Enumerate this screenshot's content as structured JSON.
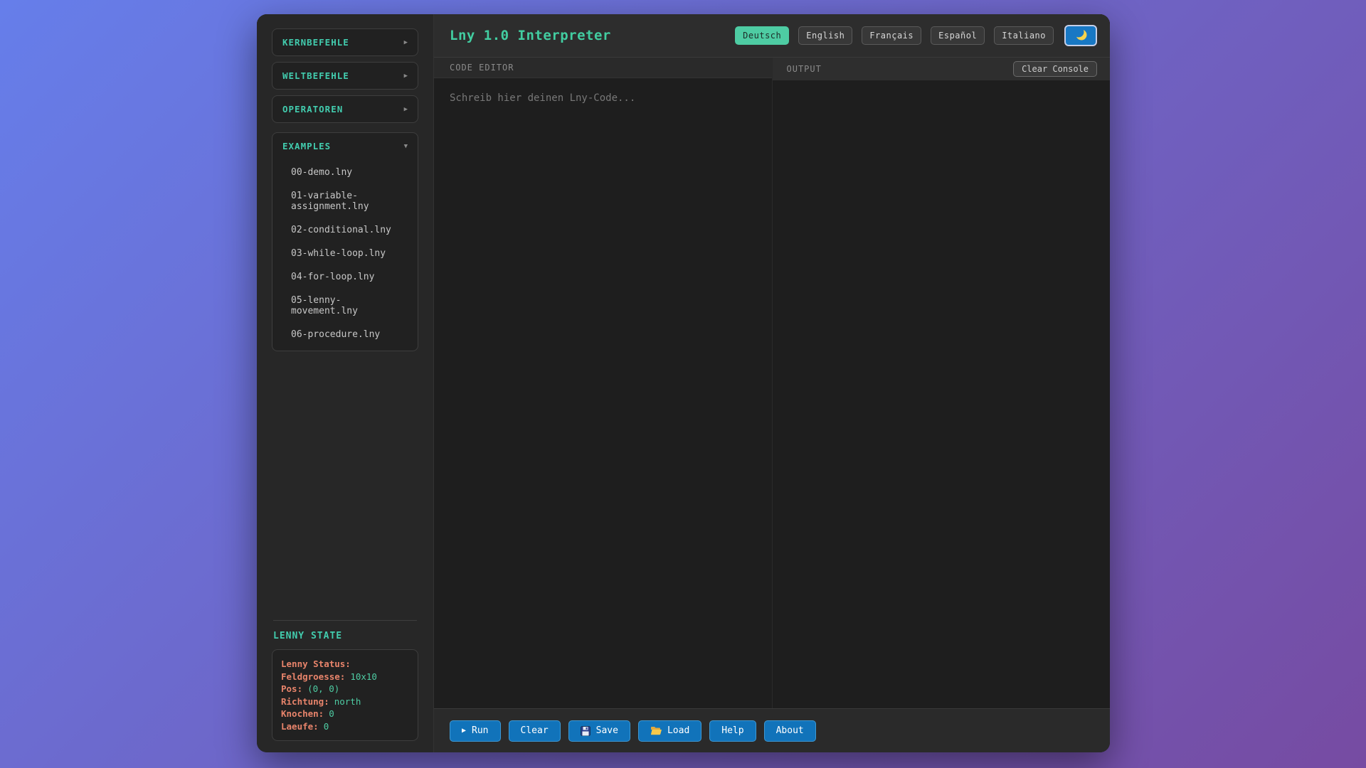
{
  "app": {
    "title": "Lny 1.0 Interpreter"
  },
  "header": {
    "languages": [
      {
        "label": "Deutsch",
        "active": true
      },
      {
        "label": "English",
        "active": false
      },
      {
        "label": "Français",
        "active": false
      },
      {
        "label": "Español",
        "active": false
      },
      {
        "label": "Italiano",
        "active": false
      }
    ],
    "theme_toggle_icon": "moon-icon"
  },
  "icons": {
    "play": "▶",
    "collapsed_arrow": "▶",
    "expanded_arrow": "▼"
  },
  "sidebar": {
    "sections": [
      {
        "label": "KERNBEFEHLE",
        "state": "collapsed",
        "arrow": "▶"
      },
      {
        "label": "WELTBEFEHLE",
        "state": "collapsed",
        "arrow": "▶"
      },
      {
        "label": "OPERATOREN",
        "state": "collapsed",
        "arrow": "▶"
      },
      {
        "label": "EXAMPLES",
        "state": "expanded",
        "arrow": "▼",
        "files": [
          "00-demo.lny",
          "01-variable-assignment.lny",
          "02-conditional.lny",
          "03-while-loop.lny",
          "04-for-loop.lny",
          "05-lenny-movement.lny",
          "06-procedure.lny"
        ]
      }
    ],
    "lenny_state": {
      "heading": "LENNY STATE",
      "status_label": "Lenny Status:",
      "fields": [
        {
          "label": "Feldgroesse:",
          "value": "10x10"
        },
        {
          "label": "Pos:",
          "value": "(0, 0)"
        },
        {
          "label": "Richtung:",
          "value": "north"
        },
        {
          "label": "Knochen:",
          "value": "0"
        },
        {
          "label": "Laeufe:",
          "value": "0"
        }
      ]
    }
  },
  "editor": {
    "panel_label": "CODE EDITOR",
    "placeholder": "Schreib hier deinen Lny-Code...",
    "value": ""
  },
  "output": {
    "panel_label": "OUTPUT",
    "clear_button": "Clear Console",
    "content": ""
  },
  "toolbar": {
    "run": "Run",
    "clear": "Clear",
    "save": "Save",
    "load": "Load",
    "help": "Help",
    "about": "About"
  },
  "colors": {
    "accent_teal": "#4ecca3",
    "sidebar_teal": "#42ccae",
    "label_salmon": "#e8846b",
    "button_blue": "#1173ba",
    "toggle_blue": "#1878c4",
    "moon_yellow": "#f8d34c",
    "gradient_start": "#667eea",
    "gradient_end": "#764ba2"
  }
}
